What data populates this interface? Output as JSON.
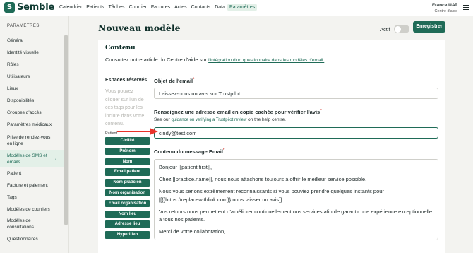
{
  "app": {
    "logo_mark": "S",
    "logo_text": "Semble"
  },
  "nav": {
    "items": [
      {
        "label": "Calendrier"
      },
      {
        "label": "Patients"
      },
      {
        "label": "Tâches"
      },
      {
        "label": "Courrier"
      },
      {
        "label": "Factures"
      },
      {
        "label": "Actes"
      },
      {
        "label": "Contacts"
      },
      {
        "label": "Data"
      },
      {
        "label": "Paramètres",
        "active": true
      }
    ]
  },
  "account": {
    "name": "France UAT",
    "sub": "Centre d'aide"
  },
  "sidebar": {
    "heading": "PARAMÈTRES",
    "items": [
      {
        "label": "Général"
      },
      {
        "label": "Identité visuelle"
      },
      {
        "label": "Rôles"
      },
      {
        "label": "Utilisateurs"
      },
      {
        "label": "Lieux"
      },
      {
        "label": "Disponibilités"
      },
      {
        "label": "Groupes d'accès"
      },
      {
        "label": "Paramètres médicaux"
      },
      {
        "label": "Prise de rendez-vous en ligne"
      },
      {
        "label": "Modèles de SMS et emails",
        "active": true
      },
      {
        "label": "Patient"
      },
      {
        "label": "Facture et paiement"
      },
      {
        "label": "Tags"
      },
      {
        "label": "Modèles de courriers"
      },
      {
        "label": "Modèles de consultations"
      },
      {
        "label": "Questionnaires"
      }
    ]
  },
  "header": {
    "title": "Nouveau modèle",
    "active_label": "Actif",
    "save_label": "Enregistrer"
  },
  "content": {
    "section_title": "Contenu",
    "intro_text": "Consultez notre article du Centre d'aide sur",
    "intro_link": "l'intégration d'un questionnaire dans les modèles d'email.",
    "vars_title": "Espaces réservés",
    "vars_help": "Vous pouvez cliquer sur l'un de ces tags pour les inclure dans votre contenu.",
    "vars_group": "Patient",
    "vars": [
      "Civilité",
      "Prénom",
      "Nom",
      "Email patient",
      "Nom praticien",
      "Nom organisation",
      "Email organisation",
      "Nom lieu",
      "Adresse lieu",
      "HyperLien"
    ],
    "subject_label": "Objet de l'email",
    "subject_value": "Laissez-nous un avis sur Trustpilot",
    "bcc_label": "Renseignez une adresse email en copie cachée pour vérifier l'avis",
    "bcc_help_prefix": "See our",
    "bcc_help_link": "guidance on verifying a Trustpilot review",
    "bcc_help_suffix": "on the help centre.",
    "bcc_value": "cindy@test.com",
    "message_label": "Contenu du message Email",
    "message_lines": [
      "Bonjour [[patient.first]],",
      "Chez [[practice.name]], nous nous attachons toujours à offrir le meilleur service possible.",
      "Nous vous serions extrêmement reconnaissants si vous pouviez prendre quelques instants pour [[{{https://replacewithlink.com}} nous laisser un avis]].",
      "Vos retours nous permettent d'améliorer continuellement nos services afin de garantir une expérience exceptionnelle à tous nos patients.",
      "Merci de votre collaboration,"
    ],
    "required_mark": "*"
  },
  "colors": {
    "brand": "#1f6b57",
    "arrow": "#e8332a",
    "required": "#d0342c"
  }
}
